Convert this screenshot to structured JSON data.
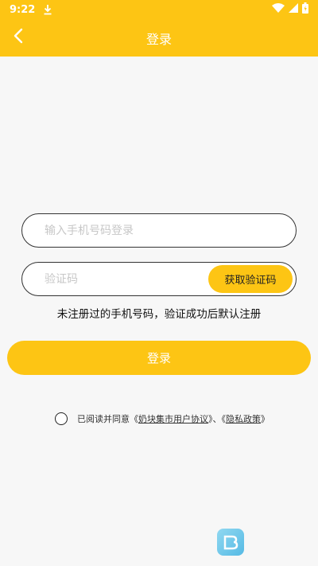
{
  "status_bar": {
    "time": "9:22",
    "icons": [
      "download-icon",
      "wifi-icon",
      "signal-icon",
      "battery-icon"
    ]
  },
  "header": {
    "title": "登录",
    "back_icon": "chevron-left-icon",
    "background": "#fdc514"
  },
  "form": {
    "phone_placeholder": "输入手机号码登录",
    "phone_value": "",
    "code_placeholder": "验证码",
    "code_value": "",
    "get_code_label": "获取验证码",
    "hint": "未注册过的手机号码，验证成功后默认注册",
    "login_label": "登录"
  },
  "agreement": {
    "prefix": "已阅读并同意《",
    "user_agreement": "奶块集市用户协议",
    "middle": "》、《",
    "privacy_policy": "隐私政策",
    "suffix": "》",
    "checked": false
  },
  "accent_color": "#fdc514"
}
